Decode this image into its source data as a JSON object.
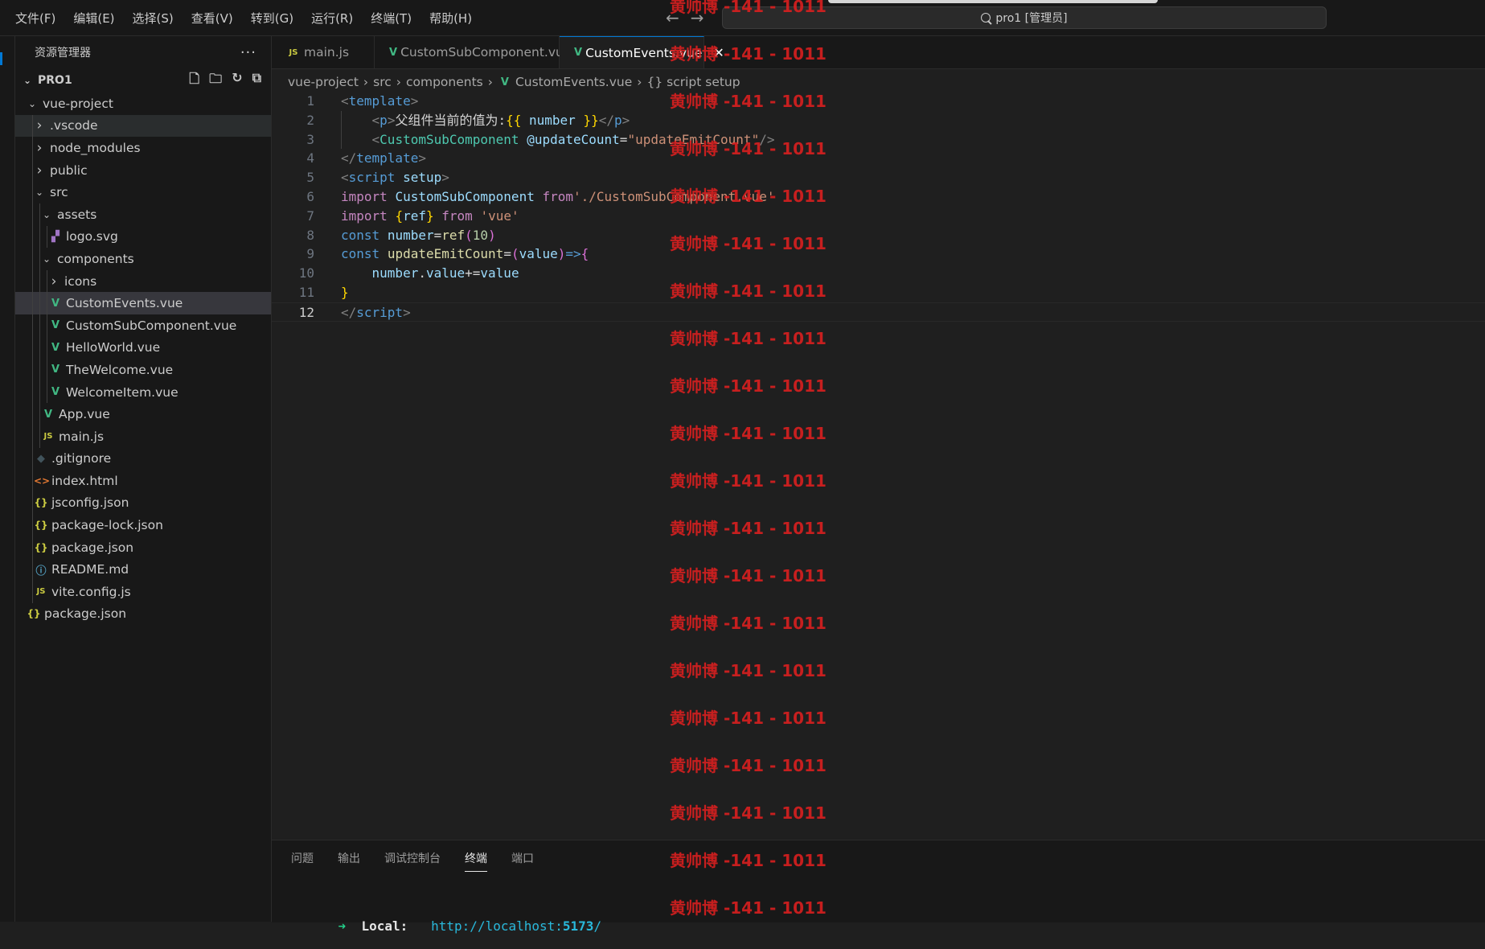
{
  "menu": [
    "文件(F)",
    "编辑(E)",
    "选择(S)",
    "查看(V)",
    "转到(G)",
    "运行(R)",
    "终端(T)",
    "帮助(H)"
  ],
  "command_center": "pro1 [管理员]",
  "explorer": {
    "title": "资源管理器",
    "more": "···",
    "root": "PRO1"
  },
  "tree": [
    {
      "label": "vue-project",
      "depth": 0,
      "type": "folder-open"
    },
    {
      "label": ".vscode",
      "depth": 1,
      "type": "folder",
      "state": "hover"
    },
    {
      "label": "node_modules",
      "depth": 1,
      "type": "folder"
    },
    {
      "label": "public",
      "depth": 1,
      "type": "folder"
    },
    {
      "label": "src",
      "depth": 1,
      "type": "folder-open"
    },
    {
      "label": "assets",
      "depth": 2,
      "type": "folder-open"
    },
    {
      "label": "logo.svg",
      "depth": 3,
      "type": "svg"
    },
    {
      "label": "components",
      "depth": 2,
      "type": "folder-open"
    },
    {
      "label": "icons",
      "depth": 3,
      "type": "folder"
    },
    {
      "label": "CustomEvents.vue",
      "depth": 3,
      "type": "vue",
      "state": "selected"
    },
    {
      "label": "CustomSubComponent.vue",
      "depth": 3,
      "type": "vue"
    },
    {
      "label": "HelloWorld.vue",
      "depth": 3,
      "type": "vue"
    },
    {
      "label": "TheWelcome.vue",
      "depth": 3,
      "type": "vue"
    },
    {
      "label": "WelcomeItem.vue",
      "depth": 3,
      "type": "vue"
    },
    {
      "label": "App.vue",
      "depth": 2,
      "type": "vue"
    },
    {
      "label": "main.js",
      "depth": 2,
      "type": "js"
    },
    {
      "label": ".gitignore",
      "depth": 1,
      "type": "git"
    },
    {
      "label": "index.html",
      "depth": 1,
      "type": "html"
    },
    {
      "label": "jsconfig.json",
      "depth": 1,
      "type": "json"
    },
    {
      "label": "package-lock.json",
      "depth": 1,
      "type": "json"
    },
    {
      "label": "package.json",
      "depth": 1,
      "type": "json"
    },
    {
      "label": "README.md",
      "depth": 1,
      "type": "info"
    },
    {
      "label": "vite.config.js",
      "depth": 1,
      "type": "js"
    },
    {
      "label": "package.json",
      "depth": 0,
      "type": "json"
    }
  ],
  "tabs": [
    {
      "label": "main.js",
      "type": "js"
    },
    {
      "label": "CustomSubComponent.vue",
      "type": "vue"
    },
    {
      "label": "CustomEvents.vue",
      "type": "vue",
      "active": true
    }
  ],
  "breadcrumb": [
    "vue-project",
    "src",
    "components",
    "CustomEvents.vue",
    "{} script setup"
  ],
  "code_lines": [
    [
      [
        "t-tag",
        "<"
      ],
      [
        "t-name",
        "template"
      ],
      [
        "t-tag",
        ">"
      ]
    ],
    [
      [
        "t-txt",
        "    "
      ],
      [
        "t-tag",
        "<"
      ],
      [
        "t-name",
        "p"
      ],
      [
        "t-tag",
        ">"
      ],
      [
        "t-txt",
        "父组件当前的值为:"
      ],
      [
        "t-br",
        "{{"
      ],
      [
        "t-txt",
        " "
      ],
      [
        "t-var",
        "number"
      ],
      [
        "t-txt",
        " "
      ],
      [
        "t-br",
        "}}"
      ],
      [
        "t-tag",
        "</"
      ],
      [
        "t-name",
        "p"
      ],
      [
        "t-tag",
        ">"
      ]
    ],
    [
      [
        "t-txt",
        "    "
      ],
      [
        "t-tag",
        "<"
      ],
      [
        "t-comp",
        "CustomSubComponent"
      ],
      [
        "t-txt",
        " "
      ],
      [
        "t-attr",
        "@updateCount"
      ],
      [
        "t-txt",
        "="
      ],
      [
        "t-str",
        "\"updateEmitCount\""
      ],
      [
        "t-tag",
        "/>"
      ]
    ],
    [
      [
        "t-tag",
        "</"
      ],
      [
        "t-name",
        "template"
      ],
      [
        "t-tag",
        ">"
      ]
    ],
    [
      [
        "t-tag",
        "<"
      ],
      [
        "t-name",
        "script"
      ],
      [
        "t-txt",
        " "
      ],
      [
        "t-attr",
        "setup"
      ],
      [
        "t-tag",
        ">"
      ]
    ],
    [
      [
        "t-kw",
        "import"
      ],
      [
        "t-txt",
        " "
      ],
      [
        "t-var",
        "CustomSubComponent"
      ],
      [
        "t-txt",
        " "
      ],
      [
        "t-kw",
        "from"
      ],
      [
        "t-str",
        "'./CustomSubComponent.vue'"
      ]
    ],
    [
      [
        "t-kw",
        "import"
      ],
      [
        "t-txt",
        " "
      ],
      [
        "t-br",
        "{"
      ],
      [
        "t-var",
        "ref"
      ],
      [
        "t-br",
        "}"
      ],
      [
        "t-txt",
        " "
      ],
      [
        "t-kw",
        "from"
      ],
      [
        "t-txt",
        " "
      ],
      [
        "t-str",
        "'vue'"
      ]
    ],
    [
      [
        "t-decl",
        "const"
      ],
      [
        "t-txt",
        " "
      ],
      [
        "t-var",
        "number"
      ],
      [
        "t-txt",
        "="
      ],
      [
        "t-fn",
        "ref"
      ],
      [
        "t-br2",
        "("
      ],
      [
        "t-num",
        "10"
      ],
      [
        "t-br2",
        ")"
      ]
    ],
    [
      [
        "t-decl",
        "const"
      ],
      [
        "t-txt",
        " "
      ],
      [
        "t-fn",
        "updateEmitCount"
      ],
      [
        "t-txt",
        "="
      ],
      [
        "t-br2",
        "("
      ],
      [
        "t-var",
        "value"
      ],
      [
        "t-br2",
        ")"
      ],
      [
        "t-decl",
        "=>"
      ],
      [
        "t-br2",
        "{"
      ]
    ],
    [
      [
        "t-txt",
        "    "
      ],
      [
        "t-var",
        "number"
      ],
      [
        "t-txt",
        "."
      ],
      [
        "t-var",
        "value"
      ],
      [
        "t-txt",
        "+="
      ],
      [
        "t-var",
        "value"
      ]
    ],
    [
      [
        "t-br",
        "}"
      ]
    ],
    [
      [
        "t-tag",
        "</"
      ],
      [
        "t-name",
        "script"
      ],
      [
        "t-tag",
        ">"
      ]
    ]
  ],
  "current_line": 12,
  "panel": {
    "tabs": [
      "问题",
      "输出",
      "调试控制台",
      "终端",
      "端口"
    ],
    "active_tab": "终端",
    "terminal": {
      "arrow": "➜",
      "label": "Local:",
      "url_prefix": "http://localhost:",
      "port": "5173",
      "url_suffix": "/"
    }
  },
  "watermark": "黄帅博 -141 - 1011"
}
